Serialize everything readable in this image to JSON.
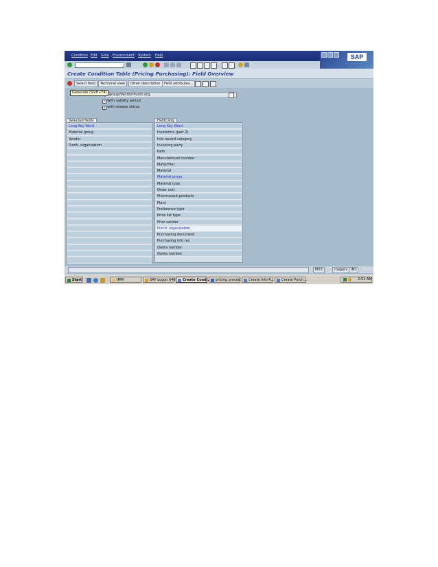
{
  "menubar": {
    "items": [
      "Condition",
      "Edit",
      "Goto",
      "Environment",
      "System",
      "Help"
    ],
    "logo_text": "SAP"
  },
  "title": "Create Condition Table (Pricing Purchasing): Field Overview",
  "app_toolbar": {
    "buttons": [
      "Select field",
      "Technical view",
      "Other description",
      "Field attributes..."
    ]
  },
  "form": {
    "tooltip": "Generate  (Shift+F4)",
    "description_value": "l group/Vendor/Purch.org.",
    "checkboxes": [
      {
        "label": "With validity period",
        "checked": true
      },
      {
        "label": "with release status",
        "checked": true
      }
    ]
  },
  "selected_fields": {
    "tab_label": "Selected fields",
    "rows": [
      "Long Key Word",
      "Material group",
      "Vendor",
      "Purch. organization",
      "",
      "",
      "",
      "",
      "",
      "",
      "",
      "",
      "",
      "",
      "",
      "",
      "",
      "",
      "",
      "",
      "",
      ""
    ]
  },
  "field_catalog": {
    "tab_label": "FieldCatlg",
    "rows": [
      "Long Key Word",
      "Incoterms (part 2)",
      "Info record category",
      "Invoicing party",
      "Item",
      "Manufacturer number",
      "MatGrHier",
      "Material",
      "Material group",
      "Material type",
      "Order unit",
      "Pharmaceut.products",
      "Plant",
      "Preference type",
      "Price list type",
      "Prior vendor",
      "Purch. organization",
      "Purchasing document",
      "Purchasing info rec",
      "Quota number",
      "Quota number"
    ]
  },
  "statusbar": {
    "system": "M03",
    "server": "magorv",
    "mode": "INS"
  },
  "taskbar": {
    "start_label": "Start",
    "items": [
      "IMM",
      "SAP Logon 640",
      "Create Cond...",
      "pricing proced...",
      "Create Info R...",
      "Create Purch..."
    ],
    "active_index": 2,
    "clock": "2:51 AM"
  },
  "colors": {
    "background": "#a6bccd",
    "menubar": "#1b2d78",
    "title": "#2b3d94",
    "highlight_text": "#2a2ad0"
  }
}
